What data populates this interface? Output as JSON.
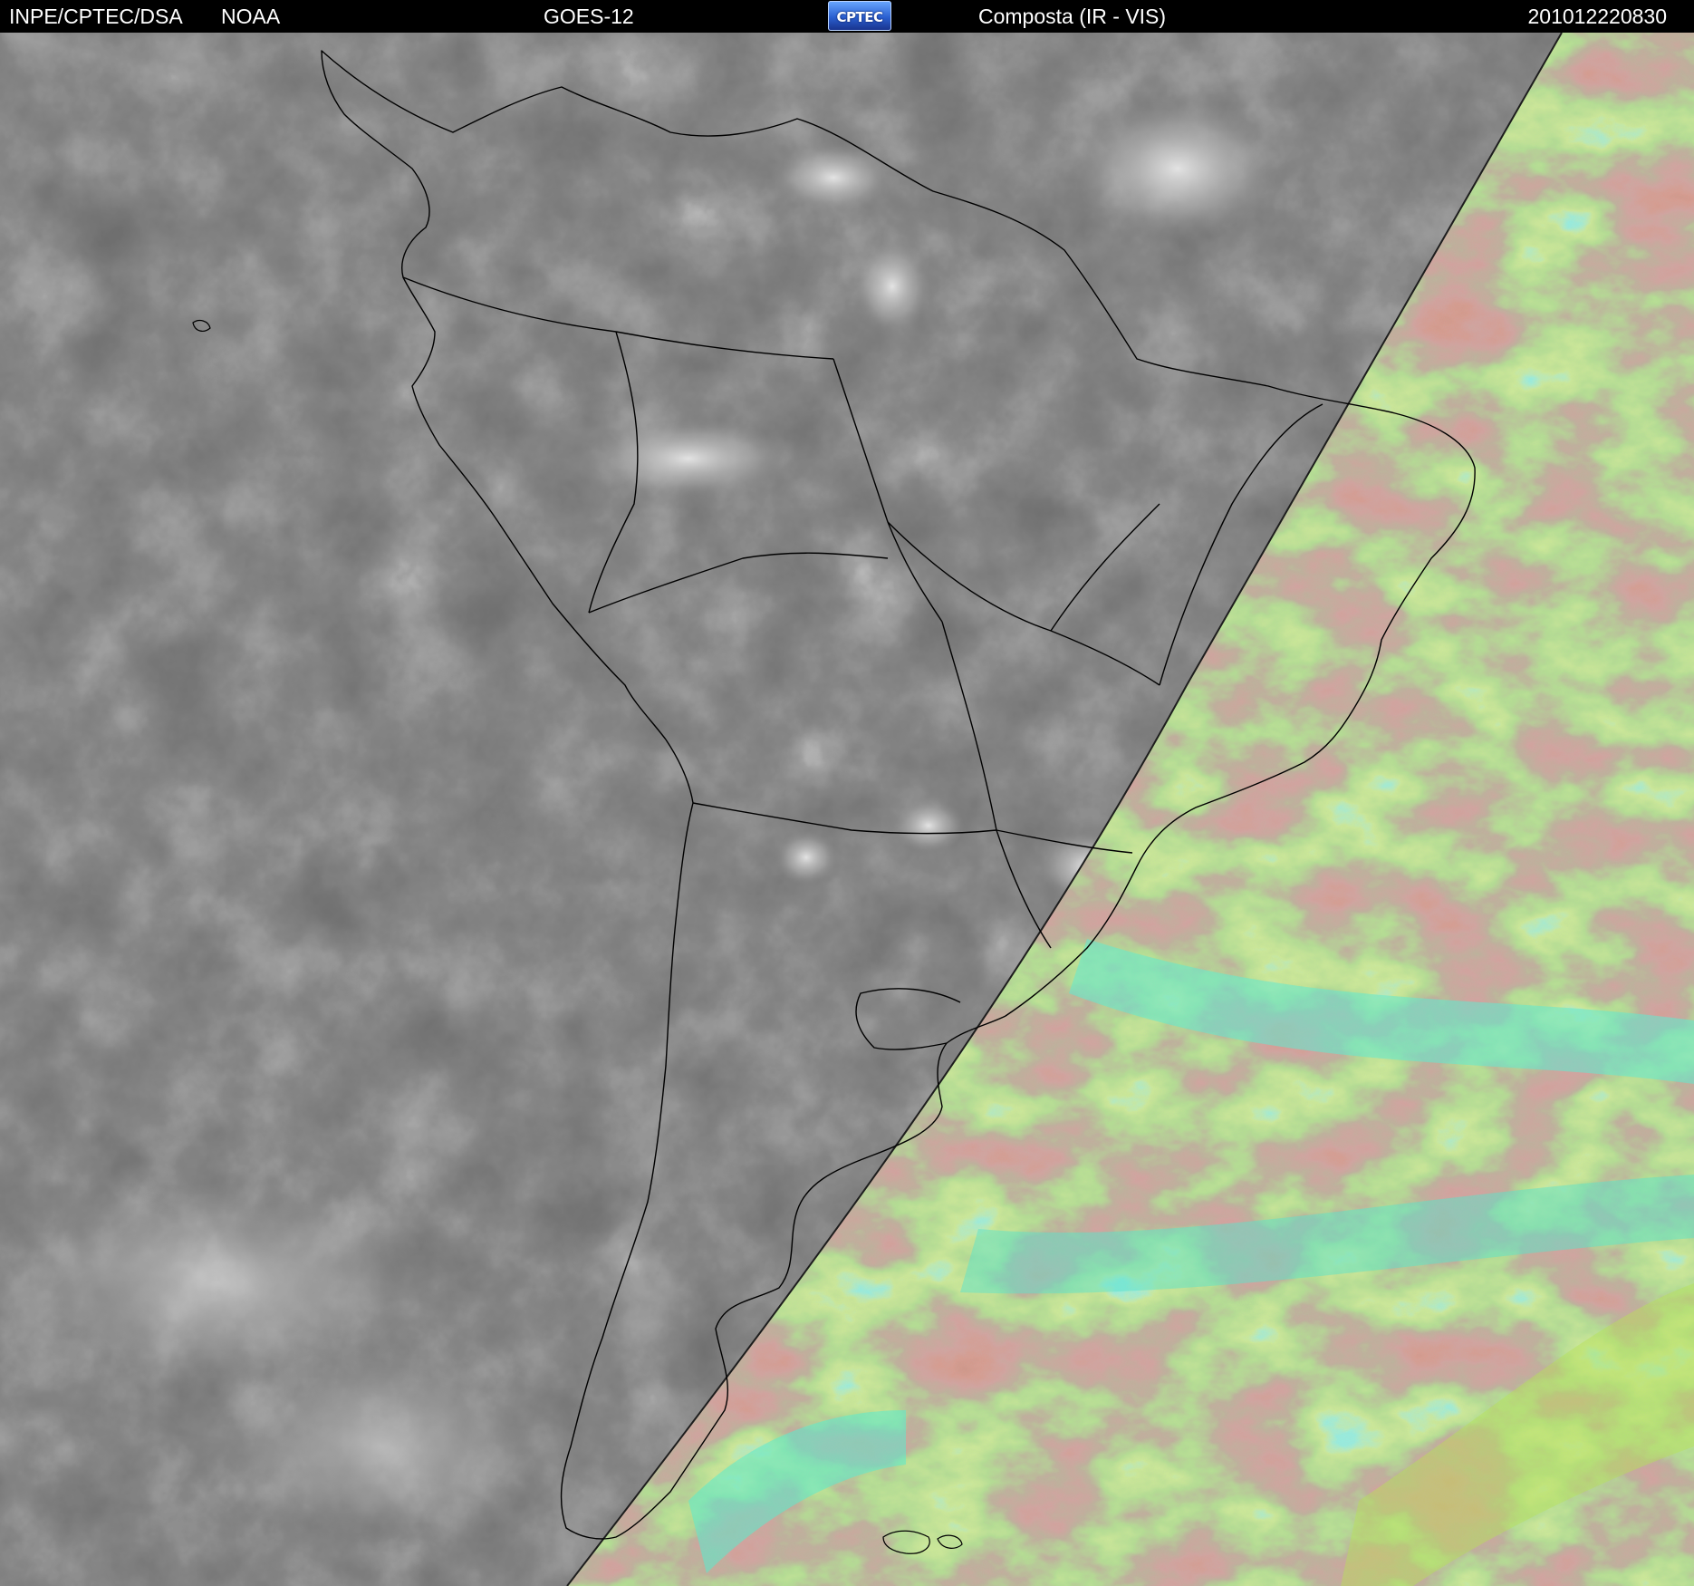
{
  "header": {
    "source": "INPE/CPTEC/DSA",
    "agency": "NOAA",
    "satellite": "GOES-12",
    "logo": {
      "text": "CPTEC",
      "icon": "cptec-logo"
    },
    "product": "Composta (IR - VIS)",
    "timestamp": "201012220830"
  },
  "imagery": {
    "night_side": {
      "colors": [
        "#2a2a2a",
        "#3a3a3a",
        "#9a9a9a",
        "#e6e6e6"
      ]
    },
    "day_side": {
      "colors": [
        "#b55a44",
        "#9a5566",
        "#8edc4e",
        "#4ff0d0",
        "#c9e64a"
      ]
    },
    "outline_color": "#000000"
  }
}
